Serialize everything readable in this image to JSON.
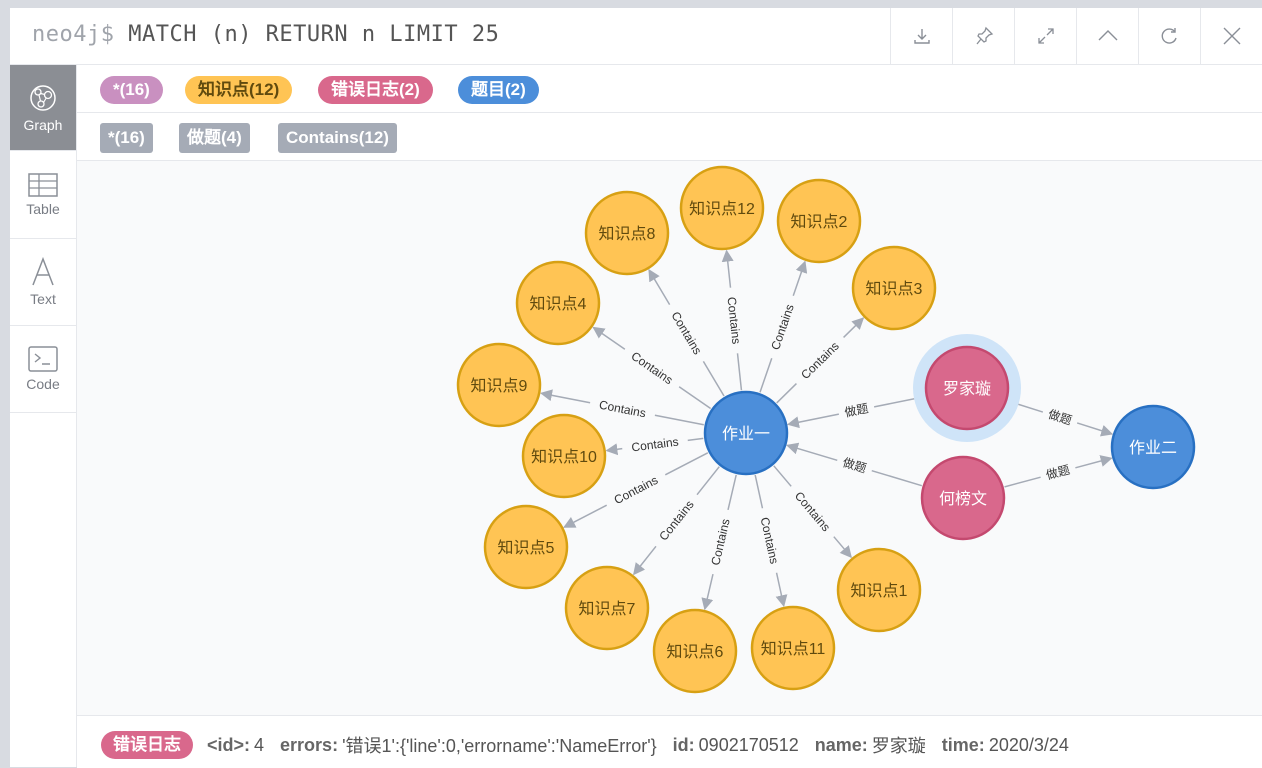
{
  "command": {
    "prompt": "neo4j$",
    "query": "MATCH (n) RETURN n LIMIT 25"
  },
  "toolbar": {
    "icons": [
      "download-icon",
      "pin-icon",
      "expand-icon",
      "collapse-icon",
      "refresh-icon",
      "close-icon"
    ]
  },
  "sidebar": {
    "items": [
      {
        "label": "Graph",
        "icon": "graph-icon",
        "active": true
      },
      {
        "label": "Table",
        "icon": "table-icon",
        "active": false
      },
      {
        "label": "Text",
        "icon": "text-icon",
        "active": false
      },
      {
        "label": "Code",
        "icon": "code-icon",
        "active": false
      }
    ]
  },
  "node_labels": [
    {
      "text": "*(16)",
      "color": "#c990c0",
      "text_color": "#ffffff"
    },
    {
      "text": "知识点(12)",
      "color": "#ffc454",
      "text_color": "#604a0e"
    },
    {
      "text": "错误日志(2)",
      "color": "#d9688c",
      "text_color": "#ffffff"
    },
    {
      "text": "题目(2)",
      "color": "#4c8eda",
      "text_color": "#ffffff"
    }
  ],
  "rel_types": [
    {
      "text": "*(16)"
    },
    {
      "text": "做题(4)"
    },
    {
      "text": "Contains(12)"
    }
  ],
  "graph": {
    "nodes": [
      {
        "id": "zy1",
        "label": "作业一",
        "type": "题目",
        "color": "#4c8eda",
        "stroke": "#2870c2",
        "text_color": "#ffffff"
      },
      {
        "id": "zy2",
        "label": "作业二",
        "type": "题目",
        "color": "#4c8eda",
        "stroke": "#2870c2",
        "text_color": "#ffffff"
      },
      {
        "id": "ljx",
        "label": "罗家璇",
        "type": "错误日志",
        "color": "#d9688c",
        "stroke": "#c4496f",
        "text_color": "#ffffff",
        "selected": true
      },
      {
        "id": "hbw",
        "label": "何榜文",
        "type": "错误日志",
        "color": "#d9688c",
        "stroke": "#c4496f",
        "text_color": "#ffffff"
      },
      {
        "id": "k1",
        "label": "知识点1",
        "type": "知识点",
        "color": "#ffc454",
        "stroke": "#d7a013",
        "text_color": "#604a0e"
      },
      {
        "id": "k2",
        "label": "知识点2",
        "type": "知识点",
        "color": "#ffc454",
        "stroke": "#d7a013",
        "text_color": "#604a0e"
      },
      {
        "id": "k3",
        "label": "知识点3",
        "type": "知识点",
        "color": "#ffc454",
        "stroke": "#d7a013",
        "text_color": "#604a0e"
      },
      {
        "id": "k4",
        "label": "知识点4",
        "type": "知识点",
        "color": "#ffc454",
        "stroke": "#d7a013",
        "text_color": "#604a0e"
      },
      {
        "id": "k5",
        "label": "知识点5",
        "type": "知识点",
        "color": "#ffc454",
        "stroke": "#d7a013",
        "text_color": "#604a0e"
      },
      {
        "id": "k6",
        "label": "知识点6",
        "type": "知识点",
        "color": "#ffc454",
        "stroke": "#d7a013",
        "text_color": "#604a0e"
      },
      {
        "id": "k7",
        "label": "知识点7",
        "type": "知识点",
        "color": "#ffc454",
        "stroke": "#d7a013",
        "text_color": "#604a0e"
      },
      {
        "id": "k8",
        "label": "知识点8",
        "type": "知识点",
        "color": "#ffc454",
        "stroke": "#d7a013",
        "text_color": "#604a0e"
      },
      {
        "id": "k9",
        "label": "知识点9",
        "type": "知识点",
        "color": "#ffc454",
        "stroke": "#d7a013",
        "text_color": "#604a0e"
      },
      {
        "id": "k10",
        "label": "知识点10",
        "type": "知识点",
        "color": "#ffc454",
        "stroke": "#d7a013",
        "text_color": "#604a0e"
      },
      {
        "id": "k11",
        "label": "知识点11",
        "type": "知识点",
        "color": "#ffc454",
        "stroke": "#d7a013",
        "text_color": "#604a0e"
      },
      {
        "id": "k12",
        "label": "知识点12",
        "type": "知识点",
        "color": "#ffc454",
        "stroke": "#d7a013",
        "text_color": "#604a0e"
      }
    ],
    "edges": [
      {
        "from": "zy1",
        "to": "k12",
        "label": "Contains"
      },
      {
        "from": "zy1",
        "to": "k2",
        "label": "Contains"
      },
      {
        "from": "zy1",
        "to": "k3",
        "label": "Contains"
      },
      {
        "from": "zy1",
        "to": "k8",
        "label": "Contains"
      },
      {
        "from": "zy1",
        "to": "k4",
        "label": "Contains"
      },
      {
        "from": "zy1",
        "to": "k9",
        "label": "Contains"
      },
      {
        "from": "zy1",
        "to": "k10",
        "label": "Contains"
      },
      {
        "from": "zy1",
        "to": "k5",
        "label": "Contains"
      },
      {
        "from": "zy1",
        "to": "k7",
        "label": "Contains"
      },
      {
        "from": "zy1",
        "to": "k6",
        "label": "Contains"
      },
      {
        "from": "zy1",
        "to": "k11",
        "label": "Contains"
      },
      {
        "from": "zy1",
        "to": "k1",
        "label": "Contains"
      },
      {
        "from": "ljx",
        "to": "zy1",
        "label": "做题"
      },
      {
        "from": "hbw",
        "to": "zy1",
        "label": "做题"
      },
      {
        "from": "ljx",
        "to": "zy2",
        "label": "做题"
      },
      {
        "from": "hbw",
        "to": "zy2",
        "label": "做题"
      }
    ]
  },
  "status": {
    "badge": "错误日志",
    "props": [
      {
        "key": "<id>:",
        "value": "4"
      },
      {
        "key": "errors:",
        "value": "'错误1':{'line':0,'errorname':'NameError'}"
      },
      {
        "key": "id:",
        "value": "0902170512"
      },
      {
        "key": "name:",
        "value": "罗家璇"
      },
      {
        "key": "time:",
        "value": "2020/3/24"
      }
    ]
  }
}
